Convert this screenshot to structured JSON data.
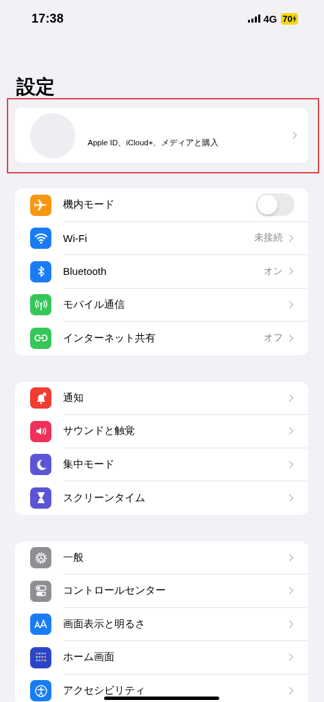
{
  "status_bar": {
    "time": "17:38",
    "network": "4G",
    "battery": "70"
  },
  "title": "設定",
  "profile": {
    "subtitle": "Apple ID、iCloud+、メディアと購入",
    "highlighted": true
  },
  "groups": [
    {
      "rows": [
        {
          "label": "機内モード",
          "kind": "toggle",
          "on": false,
          "color": "#f7960f"
        },
        {
          "label": "Wi-Fi",
          "kind": "link",
          "value": "未接続",
          "color": "#1a7cf5"
        },
        {
          "label": "Bluetooth",
          "kind": "link",
          "value": "オン",
          "color": "#1a7cf5"
        },
        {
          "label": "モバイル通信",
          "kind": "link",
          "color": "#35c759"
        },
        {
          "label": "インターネット共有",
          "kind": "link",
          "value": "オフ",
          "color": "#35c759"
        }
      ]
    },
    {
      "rows": [
        {
          "label": "通知",
          "kind": "link",
          "color": "#f23b30"
        },
        {
          "label": "サウンドと触覚",
          "kind": "link",
          "color": "#f0305a"
        },
        {
          "label": "集中モード",
          "kind": "link",
          "color": "#5b55d6"
        },
        {
          "label": "スクリーンタイム",
          "kind": "link",
          "color": "#5b55d6"
        }
      ]
    },
    {
      "rows": [
        {
          "label": "一般",
          "kind": "link",
          "color": "#8e8e93"
        },
        {
          "label": "コントロールセンター",
          "kind": "link",
          "color": "#8e8e93"
        },
        {
          "label": "画面表示と明るさ",
          "kind": "link",
          "color": "#1a7cf5"
        },
        {
          "label": "ホーム画面",
          "kind": "link",
          "color": "#2a46c8"
        },
        {
          "label": "アクセシビリティ",
          "kind": "link",
          "color": "#1a7cf5"
        }
      ]
    }
  ]
}
